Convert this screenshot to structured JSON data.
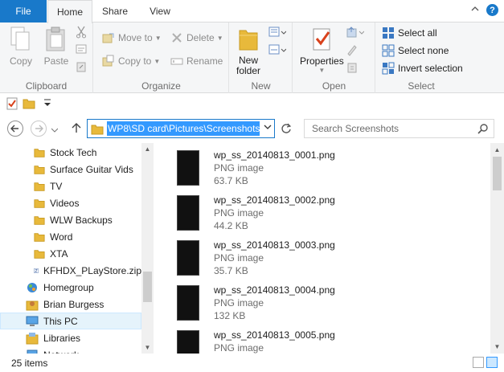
{
  "tabs": {
    "file": "File",
    "home": "Home",
    "share": "Share",
    "view": "View"
  },
  "ribbon": {
    "clipboard": {
      "label": "Clipboard",
      "copy": "Copy",
      "paste": "Paste"
    },
    "organize": {
      "label": "Organize",
      "move_to": "Move to",
      "copy_to": "Copy to",
      "delete": "Delete",
      "rename": "Rename"
    },
    "new": {
      "label": "New",
      "new_folder_line1": "New",
      "new_folder_line2": "folder"
    },
    "open": {
      "label": "Open",
      "properties": "Properties"
    },
    "select": {
      "label": "Select",
      "select_all": "Select all",
      "select_none": "Select none",
      "invert_selection": "Invert selection"
    }
  },
  "address": {
    "path": "WP8\\SD card\\Pictures\\Screenshots",
    "search_placeholder": "Search Screenshots"
  },
  "nav_pane": {
    "items": [
      {
        "label": "Stock Tech",
        "icon": "folder-icon"
      },
      {
        "label": "Surface Guitar Vids",
        "icon": "folder-icon"
      },
      {
        "label": "TV",
        "icon": "folder-icon"
      },
      {
        "label": "Videos",
        "icon": "folder-icon"
      },
      {
        "label": "WLW Backups",
        "icon": "folder-icon"
      },
      {
        "label": "Word",
        "icon": "folder-icon"
      },
      {
        "label": "XTA",
        "icon": "folder-icon"
      },
      {
        "label": "KFHDX_PLayStore.zip",
        "icon": "zip-icon"
      },
      {
        "label": "Homegroup",
        "icon": "homegroup-icon"
      },
      {
        "label": "Brian Burgess",
        "icon": "user-icon"
      },
      {
        "label": "This PC",
        "icon": "computer-icon"
      },
      {
        "label": "Libraries",
        "icon": "library-icon"
      },
      {
        "label": "Network",
        "icon": "network-icon"
      }
    ]
  },
  "files": [
    {
      "name": "wp_ss_20140813_0001.png",
      "type": "PNG image",
      "size": "63.7 KB"
    },
    {
      "name": "wp_ss_20140813_0002.png",
      "type": "PNG image",
      "size": "44.2 KB"
    },
    {
      "name": "wp_ss_20140813_0003.png",
      "type": "PNG image",
      "size": "35.7 KB"
    },
    {
      "name": "wp_ss_20140813_0004.png",
      "type": "PNG image",
      "size": "132 KB"
    },
    {
      "name": "wp_ss_20140813_0005.png",
      "type": "PNG image",
      "size": ""
    }
  ],
  "status": {
    "item_count": "25 items"
  },
  "colors": {
    "accent": "#1979ca",
    "selection": "#3399ff",
    "folder": "#e8b93b"
  }
}
